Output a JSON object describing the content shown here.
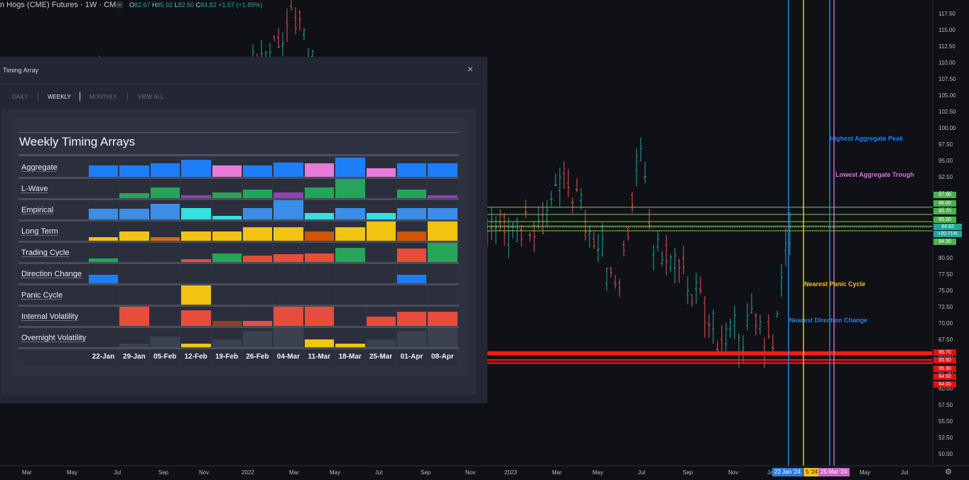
{
  "topbar": {
    "symbol": "n Hogs (CME) Futures · 1W · CME",
    "minus": "−",
    "o": "O",
    "o_val": "82.67",
    "h": "H",
    "h_val": "85.92",
    "l": "L",
    "l_val": "82.60",
    "c": "C",
    "c_val": "84.82",
    "chg": "+1.57 (+1.89%)"
  },
  "panel": {
    "title": "Timing Array",
    "close": "×",
    "tabs": [
      "DAILY",
      "WEEKLY",
      "MONTHLY",
      "VIEW ALL"
    ],
    "active_tab": "WEEKLY",
    "heading": "Weekly Timing Arrays",
    "dates": [
      "22-Jan",
      "29-Jan",
      "05-Feb",
      "12-Feb",
      "19-Feb",
      "26-Feb",
      "04-Mar",
      "11-Mar",
      "18-Mar",
      "25-Mar",
      "01-Apr",
      "08-Apr"
    ],
    "rows": [
      {
        "label": "Aggregate",
        "cells": [
          [
            0.6,
            "#1e7ef7"
          ],
          [
            0.6,
            "#1e7ef7"
          ],
          [
            0.7,
            "#1e7ef7"
          ],
          [
            0.9,
            "#1e7ef7"
          ],
          [
            0.6,
            "#e87ad9"
          ],
          [
            0.6,
            "#1e7ef7"
          ],
          [
            0.75,
            "#1e7ef7"
          ],
          [
            0.7,
            "#e87ad9"
          ],
          [
            1.0,
            "#1e7ef7"
          ],
          [
            0.45,
            "#e87ad9"
          ],
          [
            0.7,
            "#1e7ef7"
          ],
          [
            0.7,
            "#1e7ef7"
          ]
        ]
      },
      {
        "label": "L-Wave",
        "cells": [
          [
            0,
            ""
          ],
          [
            0.25,
            "#27a35a"
          ],
          [
            0.55,
            "#27a35a"
          ],
          [
            0.15,
            "#8e44ad"
          ],
          [
            0.3,
            "#27a35a"
          ],
          [
            0.45,
            "#27a35a"
          ],
          [
            0.3,
            "#8e44ad"
          ],
          [
            0.55,
            "#27a35a"
          ],
          [
            1.0,
            "#27a35a"
          ],
          [
            0,
            ""
          ],
          [
            0.45,
            "#27a35a"
          ],
          [
            0.15,
            "#8e44ad"
          ]
        ]
      },
      {
        "label": "Empirical",
        "cells": [
          [
            0.55,
            "#3a8ee8"
          ],
          [
            0.55,
            "#3a8ee8"
          ],
          [
            0.8,
            "#3a8ee8"
          ],
          [
            0.6,
            "#35e0e0"
          ],
          [
            0.2,
            "#35e0e0"
          ],
          [
            0.6,
            "#3a8ee8"
          ],
          [
            1.0,
            "#3a8ee8"
          ],
          [
            0.35,
            "#35e0e0"
          ],
          [
            0.6,
            "#3a8ee8"
          ],
          [
            0.35,
            "#35e0e0"
          ],
          [
            0.6,
            "#3a8ee8"
          ],
          [
            0.6,
            "#3a8ee8"
          ]
        ]
      },
      {
        "label": "Long Term",
        "cells": [
          [
            0.2,
            "#f2c311"
          ],
          [
            0.5,
            "#f2c311"
          ],
          [
            0.2,
            "#e2620e"
          ],
          [
            0.5,
            "#f2c311"
          ],
          [
            0.5,
            "#f2c311"
          ],
          [
            0.7,
            "#f2c311"
          ],
          [
            0.7,
            "#f2c311"
          ],
          [
            0.5,
            "#d35400"
          ],
          [
            0.7,
            "#f2c311"
          ],
          [
            1.0,
            "#f2c311"
          ],
          [
            0.5,
            "#d35400"
          ],
          [
            1.0,
            "#f2c311"
          ]
        ]
      },
      {
        "label": "Trading Cycle",
        "cells": [
          [
            0.2,
            "#27a35a"
          ],
          [
            0,
            ""
          ],
          [
            0,
            ""
          ],
          [
            0.15,
            "#e74c3c"
          ],
          [
            0.45,
            "#27a35a"
          ],
          [
            0.35,
            "#e74c3c"
          ],
          [
            0.4,
            "#e74c3c"
          ],
          [
            0.45,
            "#e74c3c"
          ],
          [
            0.75,
            "#27a35a"
          ],
          [
            0,
            ""
          ],
          [
            0.7,
            "#e74c3c"
          ],
          [
            1.0,
            "#27a35a"
          ]
        ]
      },
      {
        "label": "Direction Change",
        "cells": [
          [
            0.45,
            "#1e7ef7"
          ],
          [
            0,
            ""
          ],
          [
            0,
            ""
          ],
          [
            0,
            ""
          ],
          [
            0,
            ""
          ],
          [
            0,
            ""
          ],
          [
            0,
            ""
          ],
          [
            0,
            ""
          ],
          [
            0,
            ""
          ],
          [
            0,
            ""
          ],
          [
            0.45,
            "#1e7ef7"
          ],
          [
            0,
            ""
          ]
        ]
      },
      {
        "label": "Panic Cycle",
        "cells": [
          [
            0,
            ""
          ],
          [
            0,
            ""
          ],
          [
            0,
            ""
          ],
          [
            1.0,
            "#f2c311"
          ],
          [
            0,
            ""
          ],
          [
            0,
            ""
          ],
          [
            0,
            ""
          ],
          [
            0,
            ""
          ],
          [
            0,
            ""
          ],
          [
            0,
            ""
          ],
          [
            0,
            ""
          ],
          [
            0,
            ""
          ]
        ]
      },
      {
        "label": "Internal Volatility",
        "cells": [
          [
            0,
            ""
          ],
          [
            1.0,
            "#e74c3c"
          ],
          [
            0,
            ""
          ],
          [
            0.8,
            "#e74c3c"
          ],
          [
            0.25,
            "#9a3a2e"
          ],
          [
            0.25,
            "#e74c3c"
          ],
          [
            1.0,
            "#e74c3c"
          ],
          [
            1.0,
            "#e74c3c"
          ],
          [
            0,
            ""
          ],
          [
            0.5,
            "#e74c3c"
          ],
          [
            0.75,
            "#e74c3c"
          ],
          [
            0.75,
            "#e74c3c"
          ]
        ]
      },
      {
        "label": "Overnight Volatility",
        "cells": [
          [
            0,
            ""
          ],
          [
            0.2,
            "#3a4250"
          ],
          [
            0.55,
            "#3a4250"
          ],
          [
            0.2,
            "#f2c311"
          ],
          [
            0.4,
            "#3a4250"
          ],
          [
            0.85,
            "#3a4250"
          ],
          [
            1.0,
            "#3a4250"
          ],
          [
            0.4,
            "#f2c311"
          ],
          [
            0.2,
            "#f2c311"
          ],
          [
            0.4,
            "#3a4250"
          ],
          [
            0.85,
            "#3a4250"
          ],
          [
            1.0,
            "#3a4250"
          ]
        ]
      }
    ]
  },
  "axis": {
    "price_ticks": [
      "117.50",
      "115.00",
      "112.50",
      "110.00",
      "107.50",
      "105.00",
      "102.50",
      "100.00",
      "97.50",
      "95.00",
      "92.50",
      "90.00",
      "87.50",
      "85.00",
      "82.50",
      "80.00",
      "77.50",
      "75.00",
      "72.50",
      "70.00",
      "67.50",
      "65.00",
      "62.50",
      "60.00",
      "57.50",
      "55.00",
      "52.50",
      "50.00"
    ],
    "green_tags": [
      "87.90",
      "86.80",
      "85.70",
      "85.00",
      "84.82",
      "+20.71%",
      "84.30"
    ],
    "red_tags": [
      "65.70",
      "65.50",
      "65.30",
      "64.50",
      "64.00"
    ],
    "time_ticks": [
      "Mar",
      "May",
      "Jul",
      "Sep",
      "Nov",
      "2022",
      "Mar",
      "May",
      "Jul",
      "Sep",
      "Nov",
      "2023",
      "Mar",
      "May",
      "Jul",
      "Sep",
      "Nov",
      "Ja",
      "May",
      "Jul"
    ],
    "date_tags": [
      "22 Jan '24",
      "5 '24",
      "25 Mar '24"
    ]
  },
  "annotations": {
    "peak": "Highest Aggregate Peak",
    "trough": "Lowest Aggregate Trough",
    "panic": "Nearest Panic Cycle",
    "direction": "Nearest Direction Change"
  },
  "colors": {
    "up": "#26a69a",
    "down": "#ef5350",
    "blue_line": "#2f7fd9",
    "yellow_line": "#f2c311",
    "magenta_line": "#cc66cc",
    "green_level": "#7ec850",
    "red_level": "#ff1a1a"
  }
}
